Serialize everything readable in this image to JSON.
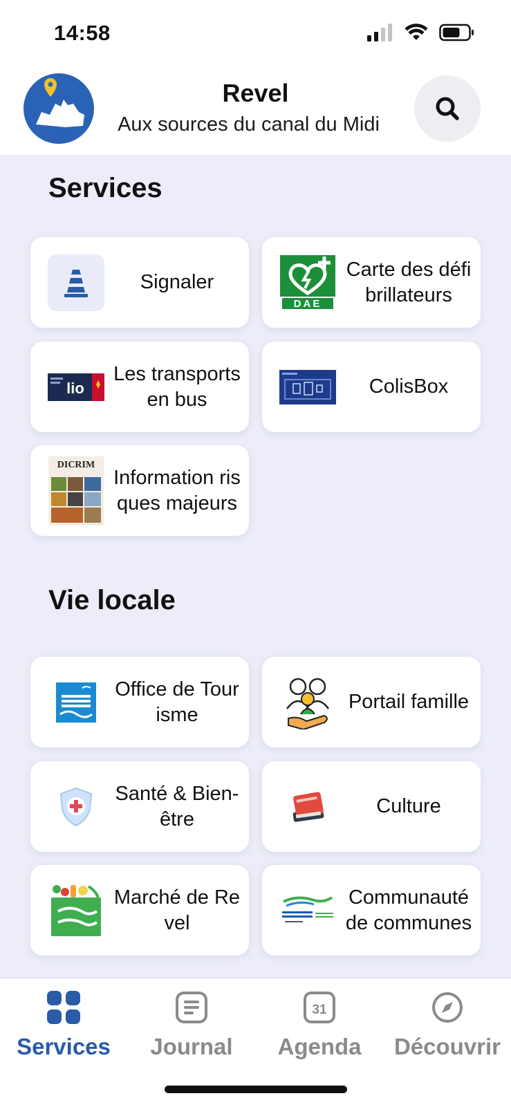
{
  "status": {
    "time": "14:58"
  },
  "header": {
    "title": "Revel",
    "subtitle": "Aux sources du canal du Midi"
  },
  "sections": {
    "services": {
      "title": "Services",
      "items": [
        {
          "label": "Signaler",
          "icon": "cone-icon"
        },
        {
          "label": "Carte des défibrillateurs",
          "icon": "defibrillator-icon",
          "icon_text": "DAE"
        },
        {
          "label": "Les transports en bus",
          "icon": "bus-transport-logo",
          "icon_text": "lio"
        },
        {
          "label": "ColisBox",
          "icon": "colisbox-image"
        },
        {
          "label": "Information risques majeurs",
          "icon": "dicrim-image",
          "icon_text": "DICRIM"
        }
      ]
    },
    "vie_locale": {
      "title": "Vie locale",
      "items": [
        {
          "label": "Office de Tourisme",
          "icon": "tourism-office-logo"
        },
        {
          "label": "Portail famille",
          "icon": "family-icon"
        },
        {
          "label": "Santé & Bien-être",
          "icon": "health-shield-icon"
        },
        {
          "label": "Culture",
          "icon": "books-icon"
        },
        {
          "label": "Marché de Revel",
          "icon": "market-basket-icon"
        },
        {
          "label": "Communauté de communes",
          "icon": "community-logo"
        }
      ]
    }
  },
  "tabs": [
    {
      "label": "Services",
      "icon": "grid-icon",
      "active": true
    },
    {
      "label": "Journal",
      "icon": "newspaper-icon"
    },
    {
      "label": "Agenda",
      "icon": "calendar-icon",
      "icon_text": "31"
    },
    {
      "label": "Découvrir",
      "icon": "compass-icon"
    }
  ],
  "colors": {
    "accent": "#2a5aa8",
    "background": "#ecedf8",
    "card": "#ffffff",
    "dae_green": "#1d8f3a"
  }
}
